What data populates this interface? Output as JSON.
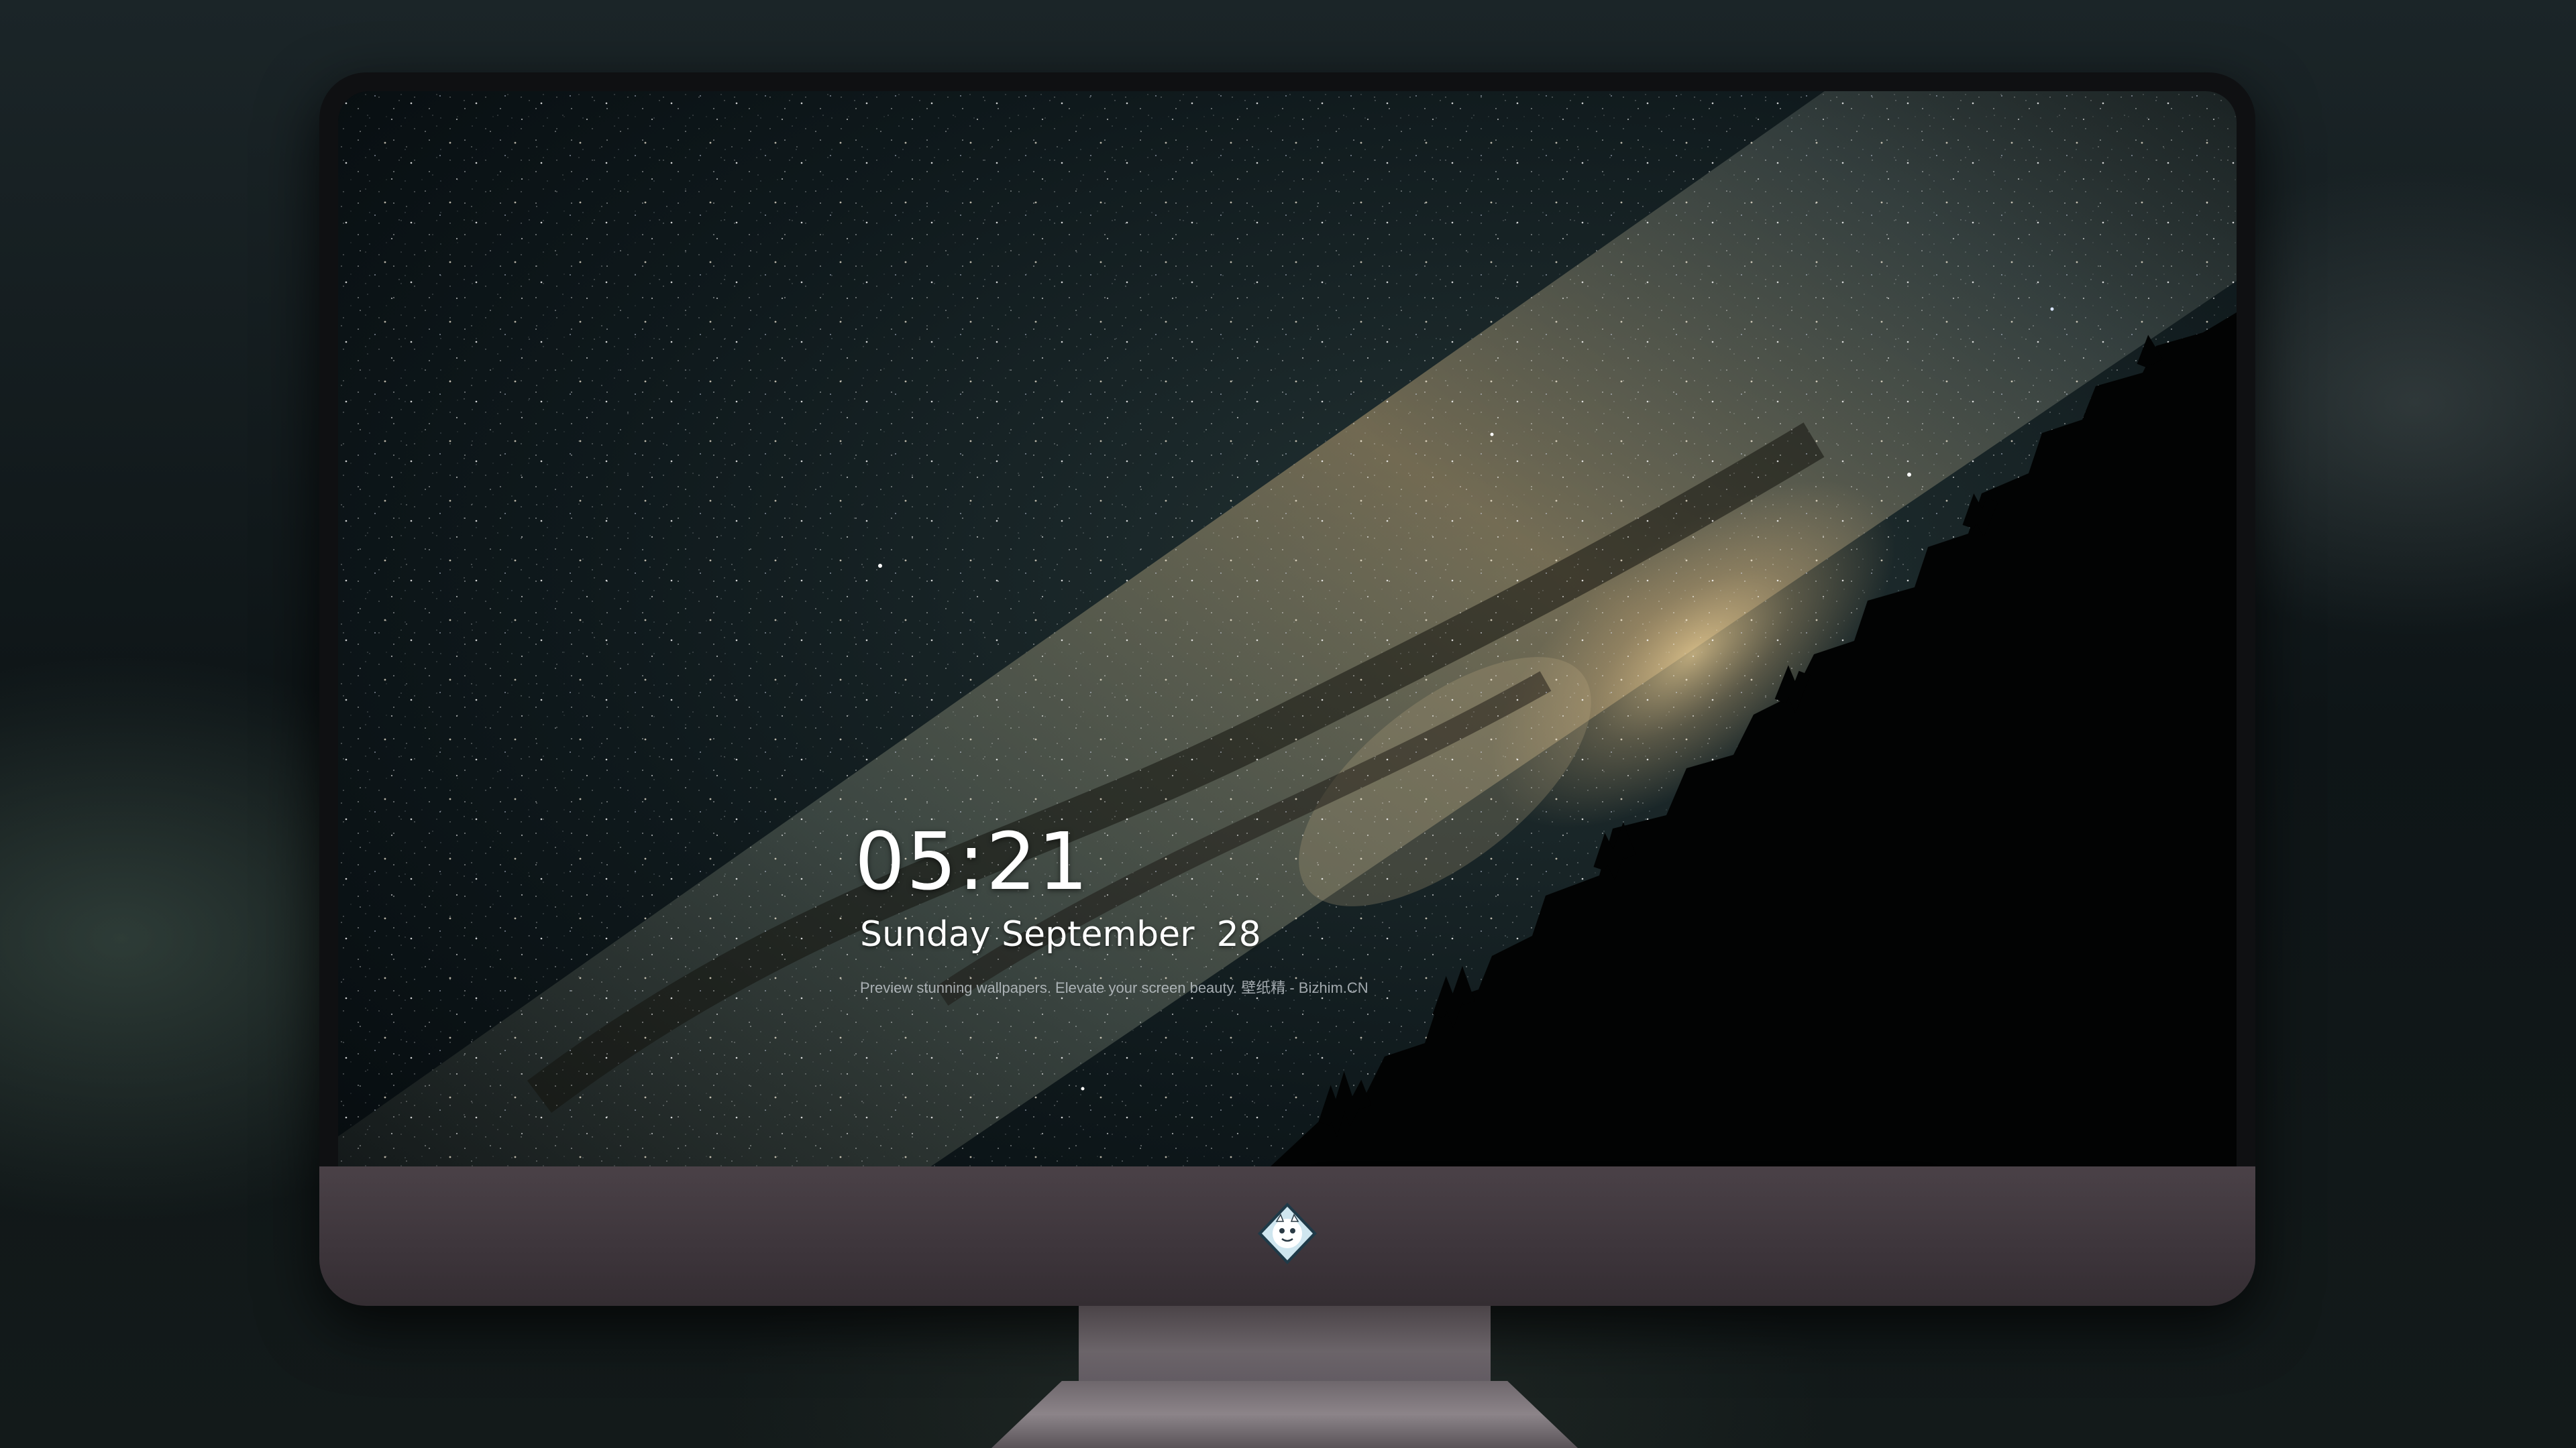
{
  "lockscreen": {
    "time": "05:21",
    "date": "Sunday September  28",
    "tagline": "Preview stunning wallpapers. Elevate your screen beauty. 壁纸精 - Bizhim.CN"
  },
  "dock": {
    "apps": [
      {
        "name": "messages-icon",
        "color": "#2fd24c"
      },
      {
        "name": "weather-icon",
        "color": "#2d8cf0"
      },
      {
        "name": "clock-icon",
        "color": "#ffffff"
      },
      {
        "name": "preview-icon",
        "color": "#e9c54a"
      },
      {
        "name": "clips-icon",
        "color": "#35b4ea"
      },
      {
        "name": "notes-icon",
        "color": "#fdd835"
      },
      {
        "name": "photo-booth-icon",
        "color": "#d84a3a"
      },
      {
        "name": "music-icon",
        "color": "#f04fd0"
      },
      {
        "name": "app-store-icon",
        "color": "#1a8cff"
      },
      {
        "name": "camera-icon",
        "color": "#8e8e93"
      }
    ]
  },
  "monitor": {
    "chin_logo": "mascot-logo-icon"
  }
}
